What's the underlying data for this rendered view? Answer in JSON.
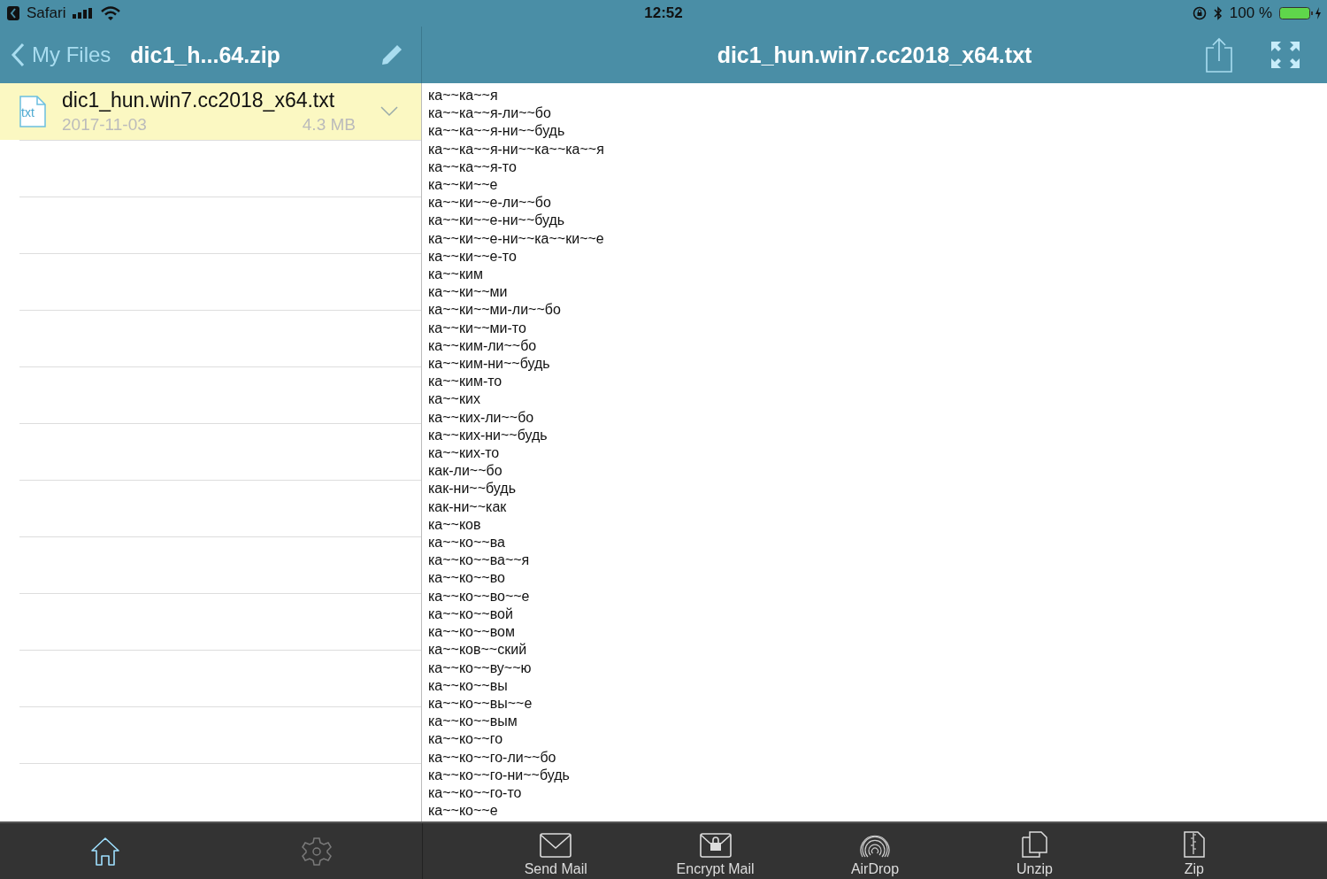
{
  "status_bar": {
    "back_app": "Safari",
    "time": "12:52",
    "battery": "100 %"
  },
  "sidebar": {
    "back": "My Files",
    "title": "dic1_h...64.zip",
    "files": [
      {
        "name": "dic1_hun.win7.cc2018_x64.txt",
        "type": "txt",
        "date": "2017-11-03",
        "size": "4.3 MB",
        "selected": true
      }
    ],
    "tabs": [
      {
        "kind": "home",
        "selected": true
      },
      {
        "kind": "settings",
        "selected": false
      }
    ]
  },
  "viewer": {
    "title": "dic1_hun.win7.cc2018_x64.txt",
    "lines": [
      "ка~~ка~~я",
      "ка~~ка~~я-ли~~бо",
      "ка~~ка~~я-ни~~будь",
      "ка~~ка~~я-ни~~ка~~ка~~я",
      "ка~~ка~~я-то",
      "ка~~ки~~е",
      "ка~~ки~~е-ли~~бо",
      "ка~~ки~~е-ни~~будь",
      "ка~~ки~~е-ни~~ка~~ки~~е",
      "ка~~ки~~е-то",
      "ка~~ким",
      "ка~~ки~~ми",
      "ка~~ки~~ми-ли~~бо",
      "ка~~ки~~ми-то",
      "ка~~ким-ли~~бо",
      "ка~~ким-ни~~будь",
      "ка~~ким-то",
      "ка~~ких",
      "ка~~ких-ли~~бо",
      "ка~~ких-ни~~будь",
      "ка~~ких-то",
      "как-ли~~бо",
      "как-ни~~будь",
      "как-ни~~как",
      "ка~~ков",
      "ка~~ко~~ва",
      "ка~~ко~~ва~~я",
      "ка~~ко~~во",
      "ка~~ко~~во~~е",
      "ка~~ко~~вой",
      "ка~~ко~~вом",
      "ка~~ков~~ский",
      "ка~~ко~~ву~~ю",
      "ка~~ко~~вы",
      "ка~~ко~~вы~~е",
      "ка~~ко~~вым",
      "ка~~ко~~го",
      "ка~~ко~~го-ли~~бо",
      "ка~~ко~~го-ни~~будь",
      "ка~~ко~~го-то",
      "ка~~ко~~е"
    ],
    "actions": [
      {
        "kind": "mail",
        "label": "Send Mail"
      },
      {
        "kind": "encrypt",
        "label": "Encrypt Mail"
      },
      {
        "kind": "airdrop",
        "label": "AirDrop"
      },
      {
        "kind": "unzip",
        "label": "Unzip"
      },
      {
        "kind": "zip",
        "label": "Zip"
      }
    ]
  }
}
